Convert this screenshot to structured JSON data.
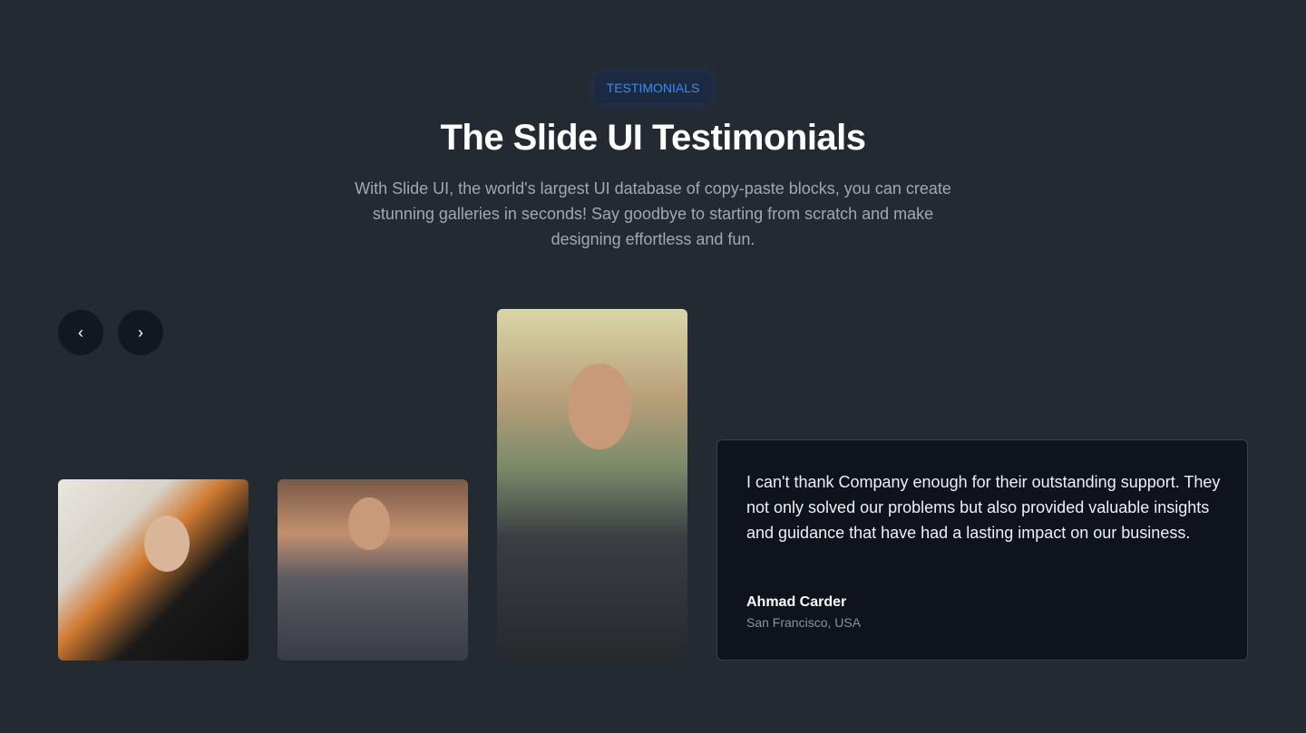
{
  "header": {
    "badge": "TESTIMONIALS",
    "title": "The Slide UI Testimonials",
    "subtitle": "With Slide UI, the world's largest UI database of copy-paste blocks, you can create stunning galleries in seconds! Say goodbye to starting from scratch and make designing effortless and fun."
  },
  "carousel": {
    "prev_icon": "chevron-left-icon",
    "next_icon": "chevron-right-icon",
    "prev_glyph": "‹",
    "next_glyph": "›"
  },
  "testimonial": {
    "quote": "I can't thank Company enough for their outstanding support. They not only solved our problems but also provided valuable insights and guidance that have had a lasting impact on our business.",
    "name": "Ahmad Carder",
    "location": "San Francisco, USA"
  },
  "colors": {
    "background": "#242a31",
    "accent": "#3b8cf0",
    "card": "#0e131c"
  }
}
